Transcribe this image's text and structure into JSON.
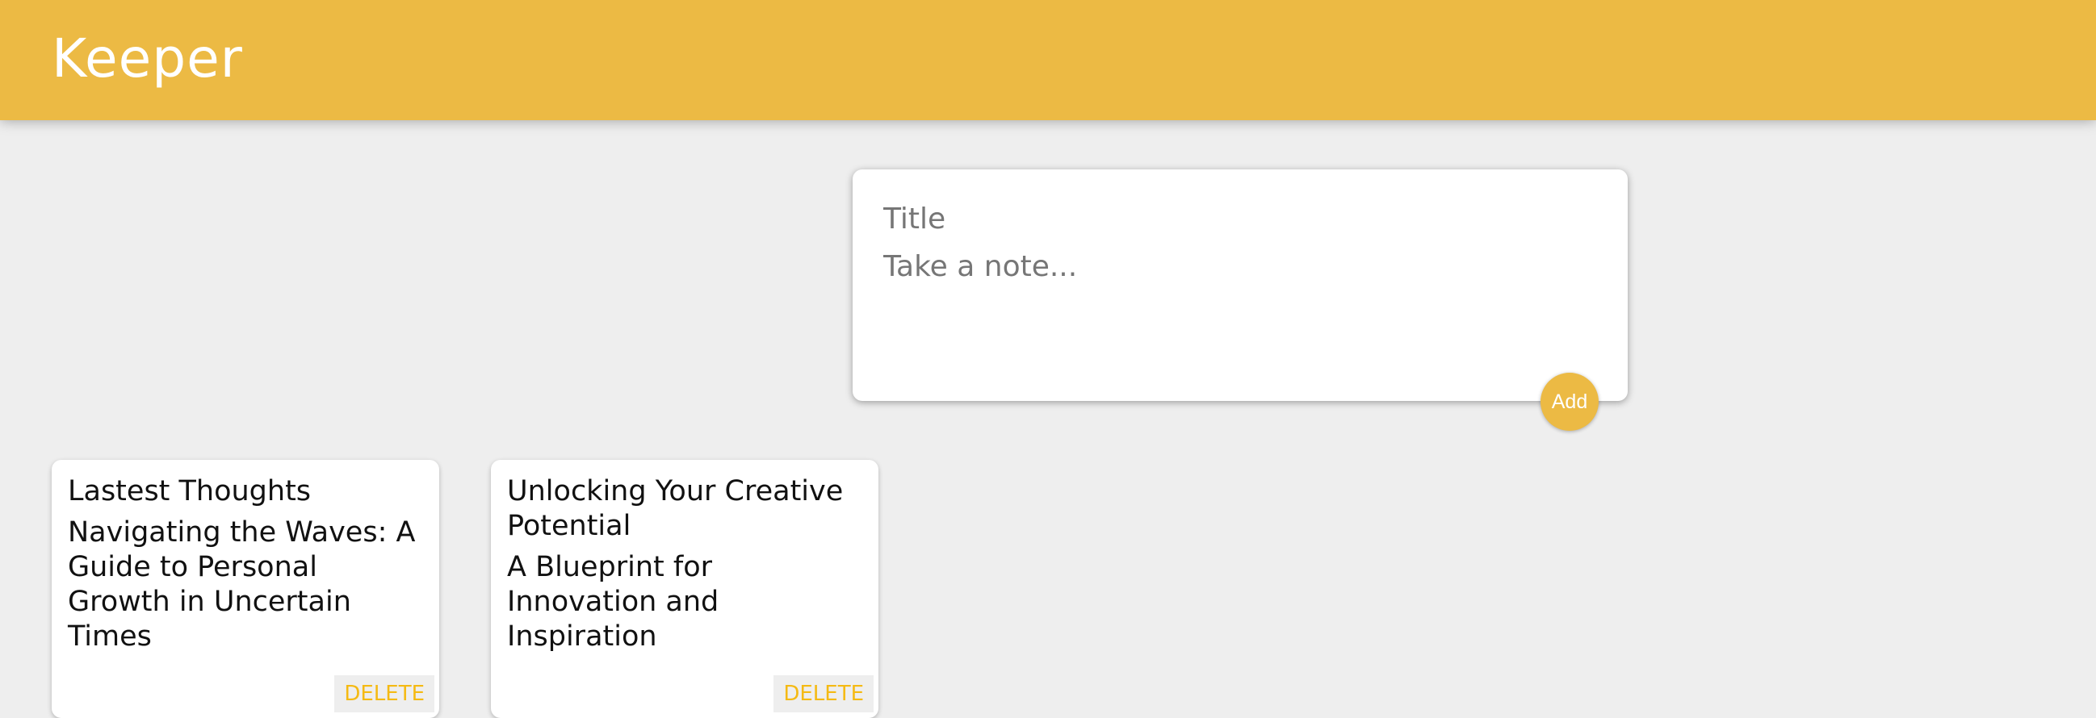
{
  "header": {
    "title": "Keeper"
  },
  "create_note": {
    "title_placeholder": "Title",
    "content_placeholder": "Take a note...",
    "add_label": "Add"
  },
  "notes": [
    {
      "title": "Lastest Thoughts",
      "content": "Navigating the Waves: A Guide to Personal Growth in Uncertain Times",
      "delete_label": "DELETE"
    },
    {
      "title": "Unlocking Your Creative Potential",
      "content": "A Blueprint for Innovation and Inspiration",
      "delete_label": "DELETE"
    }
  ],
  "colors": {
    "accent": "#ecba44",
    "delete_text": "#f5ba13",
    "background": "#eeeeee"
  }
}
